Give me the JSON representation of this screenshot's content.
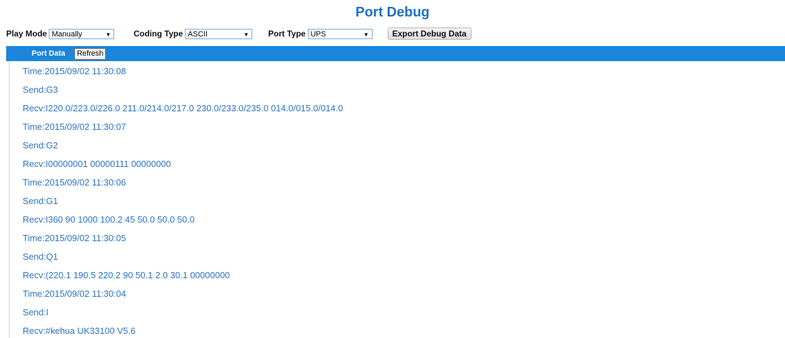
{
  "header": {
    "title": "Port Debug"
  },
  "controls": {
    "play_mode": {
      "label": "Play Mode",
      "value": "Manually"
    },
    "coding_type": {
      "label": "Coding Type",
      "value": "ASCII"
    },
    "port_type": {
      "label": "Port Type",
      "value": "UPS"
    },
    "export_label": "Export Debug Data"
  },
  "port_bar": {
    "label": "Port Data",
    "refresh_label": "Refresh"
  },
  "log": [
    "Time:2015/09/02 11:30:08",
    "Send:G3",
    "Recv:I220.0/223.0/226.0 211.0/214.0/217.0 230.0/233.0/235.0 014.0/015.0/014.0",
    "Time:2015/09/02 11:30:07",
    "Send:G2",
    "Recv:I00000001 00000111 00000000",
    "Time:2015/09/02 11:30:06",
    "Send:G1",
    "Recv:I360 90 1000 100.2 45 50.0 50.0 50.0",
    "Time:2015/09/02 11:30:05",
    "Send:Q1",
    "Recv:(220.1 190.5 220.2 90 50.1 2.0 30.1 00000000",
    "Time:2015/09/02 11:30:04",
    "Send:I",
    "Recv:#kehua UK33100 V5.6"
  ],
  "colors": {
    "title": "#1f6fc5",
    "bar": "#1b86db",
    "log_text": "#2b73c4"
  }
}
